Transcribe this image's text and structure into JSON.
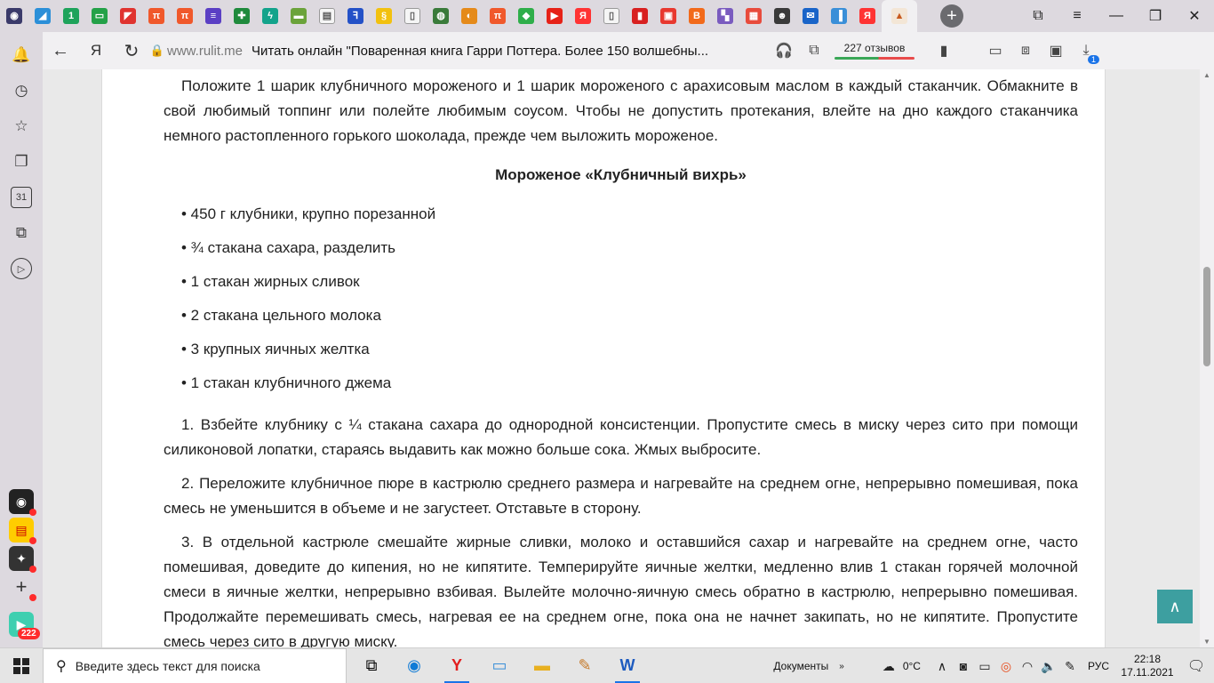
{
  "browser": {
    "tab_favicons": [
      {
        "name": "tab-favicon-1",
        "color": "#3a3a6a",
        "glyph": "◉"
      },
      {
        "name": "tab-favicon-2",
        "color": "#2b8fd8",
        "glyph": "◢"
      },
      {
        "name": "tab-favicon-3",
        "color": "#1ea35b",
        "glyph": "1"
      },
      {
        "name": "tab-favicon-4",
        "color": "#24a148",
        "glyph": "▭"
      },
      {
        "name": "tab-favicon-5",
        "color": "#e0332f",
        "glyph": "◤"
      },
      {
        "name": "tab-favicon-6",
        "color": "#f0582b",
        "glyph": "π"
      },
      {
        "name": "tab-favicon-7",
        "color": "#f0582b",
        "glyph": "π"
      },
      {
        "name": "tab-favicon-8",
        "color": "#5b3fc4",
        "glyph": "≡"
      },
      {
        "name": "tab-favicon-9",
        "color": "#1f8a3c",
        "glyph": "✚"
      },
      {
        "name": "tab-favicon-10",
        "color": "#13a38b",
        "glyph": "ϟ"
      },
      {
        "name": "tab-favicon-11",
        "color": "#6ba33a",
        "glyph": "▬"
      },
      {
        "name": "tab-favicon-12",
        "color": "#f5f5f5",
        "glyph": "▤"
      },
      {
        "name": "tab-favicon-13",
        "color": "#2451c7",
        "glyph": "ꟻ"
      },
      {
        "name": "tab-favicon-14",
        "color": "#f2c10f",
        "glyph": "§"
      },
      {
        "name": "tab-favicon-15",
        "color": "#f5f5f5",
        "glyph": "▯"
      },
      {
        "name": "tab-favicon-16",
        "color": "#3a7b3a",
        "glyph": "◍"
      },
      {
        "name": "tab-favicon-17",
        "color": "#e58a1a",
        "glyph": "◐"
      },
      {
        "name": "tab-favicon-18",
        "color": "#f0582b",
        "glyph": "π"
      },
      {
        "name": "tab-favicon-19",
        "color": "#2fae4a",
        "glyph": "◆"
      },
      {
        "name": "tab-favicon-20",
        "color": "#e62117",
        "glyph": "▶"
      },
      {
        "name": "tab-favicon-21",
        "color": "#f33",
        "glyph": "Я"
      },
      {
        "name": "tab-favicon-22",
        "color": "#f5f5f5",
        "glyph": "▯"
      },
      {
        "name": "tab-favicon-23",
        "color": "#d82020",
        "glyph": "▮"
      },
      {
        "name": "tab-favicon-24",
        "color": "#e8382f",
        "glyph": "▣"
      },
      {
        "name": "tab-favicon-25",
        "color": "#f26a1b",
        "glyph": "B"
      },
      {
        "name": "tab-favicon-26",
        "color": "#7a5bbf",
        "glyph": "▚"
      },
      {
        "name": "tab-favicon-27",
        "color": "#e84b3c",
        "glyph": "▦"
      },
      {
        "name": "tab-favicon-28",
        "color": "#3a3a3a",
        "glyph": "☻"
      },
      {
        "name": "tab-favicon-29",
        "color": "#1a64c8",
        "glyph": "✉"
      },
      {
        "name": "tab-favicon-30",
        "color": "#3a8fd8",
        "glyph": "▐"
      },
      {
        "name": "tab-favicon-31",
        "color": "#f33",
        "glyph": "Я"
      }
    ],
    "active_tab_glyph": "▲",
    "new_tab_glyph": "+",
    "window_controls": {
      "tabs_icon": "⧉",
      "menu_icon": "≡",
      "minimize": "—",
      "restore": "❐",
      "close": "✕"
    }
  },
  "sidebar": {
    "icons": [
      {
        "name": "notifications-icon",
        "glyph": "🔔"
      },
      {
        "name": "history-icon",
        "glyph": "◷"
      },
      {
        "name": "bookmarks-icon",
        "glyph": "☆"
      },
      {
        "name": "collections-icon",
        "glyph": "❐"
      },
      {
        "name": "calendar-icon",
        "glyph": "31"
      },
      {
        "name": "screenshot-icon",
        "glyph": "⧉"
      },
      {
        "name": "play-icon",
        "glyph": "▷"
      }
    ],
    "apps": [
      {
        "name": "sidebar-app-alice",
        "glyph": "◉",
        "color": "#222"
      },
      {
        "name": "sidebar-app-market",
        "glyph": "▤",
        "color": "#ffcc00"
      },
      {
        "name": "sidebar-app-zen",
        "glyph": "✦",
        "color": "#333"
      },
      {
        "name": "sidebar-app-add",
        "glyph": "+",
        "color": "#ddd9df"
      }
    ],
    "messenger_badge": "222"
  },
  "navbar": {
    "back": "←",
    "yandex": "Я",
    "reload": "↻",
    "domain": "www.rulit.me",
    "title": "Читать онлайн \"Поваренная книга Гарри Поттера. Более 150 волшебны...",
    "reviews": "227 отзывов",
    "downloads_badge": "1"
  },
  "article": {
    "intro": "Положите 1 шарик клубничного мороженого и 1 шарик мороженого с арахисовым маслом в каждый стаканчик. Обмакните в свой любимый топпинг или полейте любимым соусом. Чтобы не допустить протекания, влейте на дно каждого стаканчика немного растопленного горького шоколада, прежде чем выложить мороженое.",
    "recipe_title": "Мороженое «Клубничный вихрь»",
    "ingredients": [
      "• 450 г клубники, крупно порезанной",
      "• ¾ стакана сахара, разделить",
      "• 1 стакан жирных сливок",
      "• 2 стакана цельного молока",
      "• 3 крупных яичных желтка",
      "• 1 стакан клубничного джема"
    ],
    "steps": [
      "1. Взбейте клубнику с ¼ стакана сахара до однородной консистенции. Пропустите смесь в миску через сито при помощи силиконовой лопатки, стараясь выдавить как можно больше сока. Жмых выбросите.",
      "2. Переложите клубничное пюре в кастрюлю среднего размера и нагревайте на среднем огне, непрерывно помешивая, пока смесь не уменьшится в объеме и не загустеет. Отставьте в сторону.",
      "3. В отдельной кастрюле смешайте жирные сливки, молоко и оставшийся сахар и нагревайте на среднем огне, часто помешивая, доведите до кипения, но не кипятите. Темперируйте яичные желтки, медленно влив 1 стакан горячей молочной смеси в яичные желтки, непрерывно взбивая. Вылейте молочно-яичную смесь обратно в кастрюлю, непрерывно помешивая. Продолжайте перемешивать смесь, нагревая ее на среднем огне, пока она не начнет закипать, но не кипятите. Пропустите смесь через сито в другую миску."
    ],
    "scroll_top_glyph": "∧"
  },
  "taskbar": {
    "search_placeholder": "Введите здесь текст для поиска",
    "documents_label": "Документы",
    "weather": "0°C",
    "language": "РУС",
    "time": "22:18",
    "date": "17.11.2021"
  },
  "colors": {
    "accent_teal": "#3d9fa0",
    "browser_chrome": "#ddd9df"
  }
}
